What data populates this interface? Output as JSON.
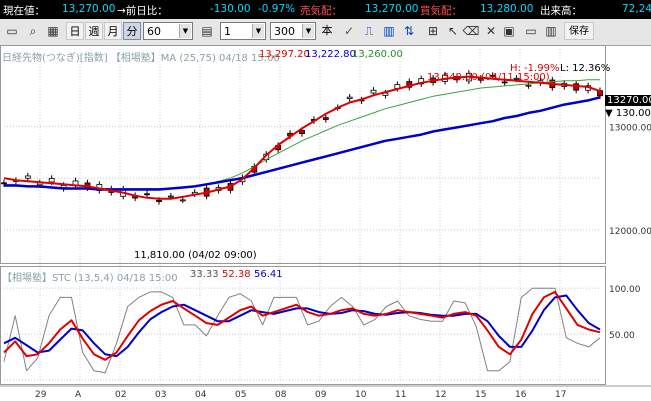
{
  "quote": {
    "current_label": "現在値：",
    "current_value": "13,270.00",
    "prev_label": "→前日比：",
    "change": "-130.00",
    "change_pct": "-0.97%",
    "ask_label": "売気配：",
    "ask_value": "13,270.00",
    "bid_label": "買気配：",
    "bid_value": "13,280.00",
    "volume_label": "出来高：",
    "volume_value": "72,24"
  },
  "toolbar": {
    "day": "日",
    "week": "週",
    "month": "月",
    "minute": "分",
    "minute_value": "60",
    "n_value": "1",
    "count_value": "300",
    "book": "本",
    "save": "保存"
  },
  "main_header": {
    "instrument": "日経先物(つなぎ)[指数] 【相場塾】MA (25,75) 04/18 15:00",
    "v1": "13,297.20",
    "v2": "13,222.80",
    "v3": "13,260.00",
    "h_pct": "H: -1.99%",
    "l_pct": "L: 12.36%"
  },
  "annotations": {
    "high": "13,540.00 (04/11 15:00)",
    "low": "11,810.00 (04/02 09:00)"
  },
  "price_tag": "13270.00",
  "price_change_tag": "▼ 130.00",
  "sub_header": {
    "label": "【相場塾】STC (13,5,4) 04/18 15:00",
    "v1": "33.33",
    "v2": "52.38",
    "v3": "56.41"
  },
  "colors": {
    "candle_up": "#ffffff",
    "candle_down": "#c00000",
    "ma_short": "#e00000",
    "ma_long": "#0000cc",
    "ma_green": "#40a040",
    "stc_k": "#e00000",
    "stc_d": "#0000cc",
    "stc_raw": "#808080"
  },
  "chart_data": {
    "type": "line",
    "x_labels": [
      "29",
      "A",
      "02",
      "03",
      "04",
      "05",
      "08",
      "09",
      "10",
      "11",
      "12",
      "15",
      "16",
      "17"
    ],
    "price_axis": {
      "ticks": [
        12000,
        12500,
        13000
      ],
      "tick_labels": [
        "12000.00",
        "",
        "13000.00"
      ],
      "ylim": [
        11700,
        13650
      ]
    },
    "stc_axis": {
      "ticks": [
        0,
        50,
        100
      ],
      "tick_labels": [
        "",
        "50.00",
        "100.00"
      ],
      "ylim": [
        0,
        110
      ]
    },
    "ma_short": [
      12500,
      12480,
      12470,
      12460,
      12450,
      12440,
      12430,
      12420,
      12400,
      12380,
      12360,
      12330,
      12310,
      12300,
      12300,
      12320,
      12340,
      12360,
      12390,
      12420,
      12490,
      12600,
      12720,
      12820,
      12900,
      12980,
      13050,
      13120,
      13180,
      13230,
      13260,
      13300,
      13330,
      13360,
      13390,
      13420,
      13440,
      13460,
      13470,
      13480,
      13470,
      13460,
      13450,
      13440,
      13430,
      13420,
      13410,
      13400,
      13390,
      13380,
      13340
    ],
    "ma_long": [
      12430,
      12430,
      12420,
      12420,
      12410,
      12400,
      12400,
      12400,
      12390,
      12390,
      12390,
      12390,
      12390,
      12390,
      12400,
      12410,
      12420,
      12440,
      12460,
      12480,
      12500,
      12530,
      12560,
      12590,
      12620,
      12650,
      12680,
      12710,
      12740,
      12770,
      12800,
      12830,
      12860,
      12880,
      12900,
      12920,
      12950,
      12970,
      12990,
      13010,
      13030,
      13050,
      13080,
      13100,
      13130,
      13150,
      13180,
      13210,
      13230,
      13250,
      13280
    ],
    "ma_green": [
      12420,
      12420,
      12420,
      12410,
      12410,
      12410,
      12400,
      12400,
      12400,
      12400,
      12400,
      12400,
      12400,
      12400,
      12400,
      12410,
      12420,
      12440,
      12470,
      12500,
      12550,
      12610,
      12680,
      12740,
      12800,
      12860,
      12910,
      12960,
      13010,
      13050,
      13090,
      13130,
      13170,
      13200,
      13230,
      13260,
      13290,
      13310,
      13330,
      13350,
      13370,
      13380,
      13390,
      13400,
      13410,
      13420,
      13430,
      13440,
      13440,
      13450,
      13450
    ],
    "stc_k": [
      30,
      42,
      26,
      28,
      40,
      55,
      65,
      45,
      28,
      22,
      30,
      48,
      65,
      75,
      82,
      86,
      78,
      70,
      62,
      60,
      68,
      76,
      80,
      70,
      74,
      78,
      82,
      74,
      70,
      72,
      76,
      78,
      72,
      70,
      72,
      76,
      74,
      72,
      70,
      68,
      72,
      74,
      70,
      54,
      36,
      28,
      44,
      72,
      90,
      96,
      78,
      60,
      55,
      52
    ],
    "stc_d": [
      40,
      46,
      38,
      30,
      32,
      44,
      56,
      54,
      40,
      28,
      26,
      36,
      52,
      66,
      74,
      80,
      82,
      76,
      70,
      64,
      64,
      70,
      76,
      74,
      72,
      75,
      78,
      78,
      74,
      72,
      73,
      76,
      75,
      72,
      71,
      73,
      74,
      73,
      71,
      70,
      70,
      72,
      72,
      64,
      48,
      36,
      36,
      54,
      76,
      90,
      92,
      76,
      62,
      55
    ],
    "stc_raw": [
      20,
      70,
      10,
      24,
      70,
      90,
      90,
      30,
      10,
      8,
      40,
      80,
      90,
      96,
      96,
      90,
      60,
      60,
      48,
      70,
      90,
      94,
      86,
      60,
      90,
      90,
      90,
      60,
      64,
      80,
      90,
      80,
      60,
      66,
      80,
      86,
      70,
      66,
      64,
      64,
      86,
      84,
      58,
      10,
      10,
      20,
      90,
      100,
      100,
      100,
      46,
      40,
      36,
      46
    ]
  }
}
